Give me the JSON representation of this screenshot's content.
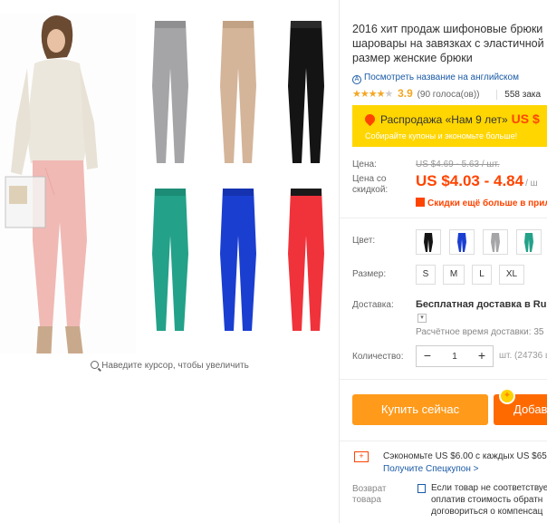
{
  "gallery": {
    "zoom_hint": "Наведите курсор, чтобы увеличить",
    "thumbnails": [
      {
        "name": "grey-pants",
        "color": "#a5a5a8"
      },
      {
        "name": "beige-pants",
        "color": "#d4b59a"
      },
      {
        "name": "black-pants",
        "color": "#141414"
      },
      {
        "name": "teal-pants",
        "color": "#23a189"
      },
      {
        "name": "blue-pants",
        "color": "#1a3ed0"
      },
      {
        "name": "red-pants",
        "color": "#f0323a"
      }
    ]
  },
  "product": {
    "title_lines": [
      "2016 хит продаж шифоновые брюки",
      "шаровары на завязках с эластичной",
      "размер женские брюки"
    ],
    "translate_link": "Посмотреть название на английском",
    "stars": "★★★★",
    "star_empty": "★",
    "rating": "3.9",
    "reviews": "(90 голоса(ов))",
    "orders": "558 зака"
  },
  "sale": {
    "title": "Распродажа «Нам 9 лет»",
    "price": "US $",
    "subtitle": "Собирайте купоны и экономьте больше!"
  },
  "price": {
    "label": "Цена:",
    "old": "US $4.69 - 5.63 / шт.",
    "discount_label_1": "Цена со",
    "discount_label_2": "скидкой:",
    "current": "US $4.03 - 4.84",
    "suffix": "/ ш",
    "discount_note": "Скидки ещё больше в прил"
  },
  "options": {
    "color_label": "Цвет:",
    "size_label": "Размер:",
    "sizes": [
      "S",
      "M",
      "L",
      "XL"
    ]
  },
  "shipping": {
    "label": "Доставка:",
    "title": "Бесплатная доставка в Russi",
    "time": "Расчётное время доставки: 35"
  },
  "quantity": {
    "label": "Количество:",
    "value": "1",
    "minus": "−",
    "plus": "+",
    "unit": "шт. (24736 ш"
  },
  "actions": {
    "buy": "Купить сейчас",
    "cart": "Добав"
  },
  "promo": {
    "text": "Сэкономьте US $6.00 с каждых US $65.",
    "link": "Получите Спецкупон >"
  },
  "returns": {
    "label_1": "Возврат",
    "label_2": "товара",
    "line1": "Если товар не соответствуе",
    "line2": "оплатив стоимость обратн",
    "line3": "договориться о компенсац"
  }
}
